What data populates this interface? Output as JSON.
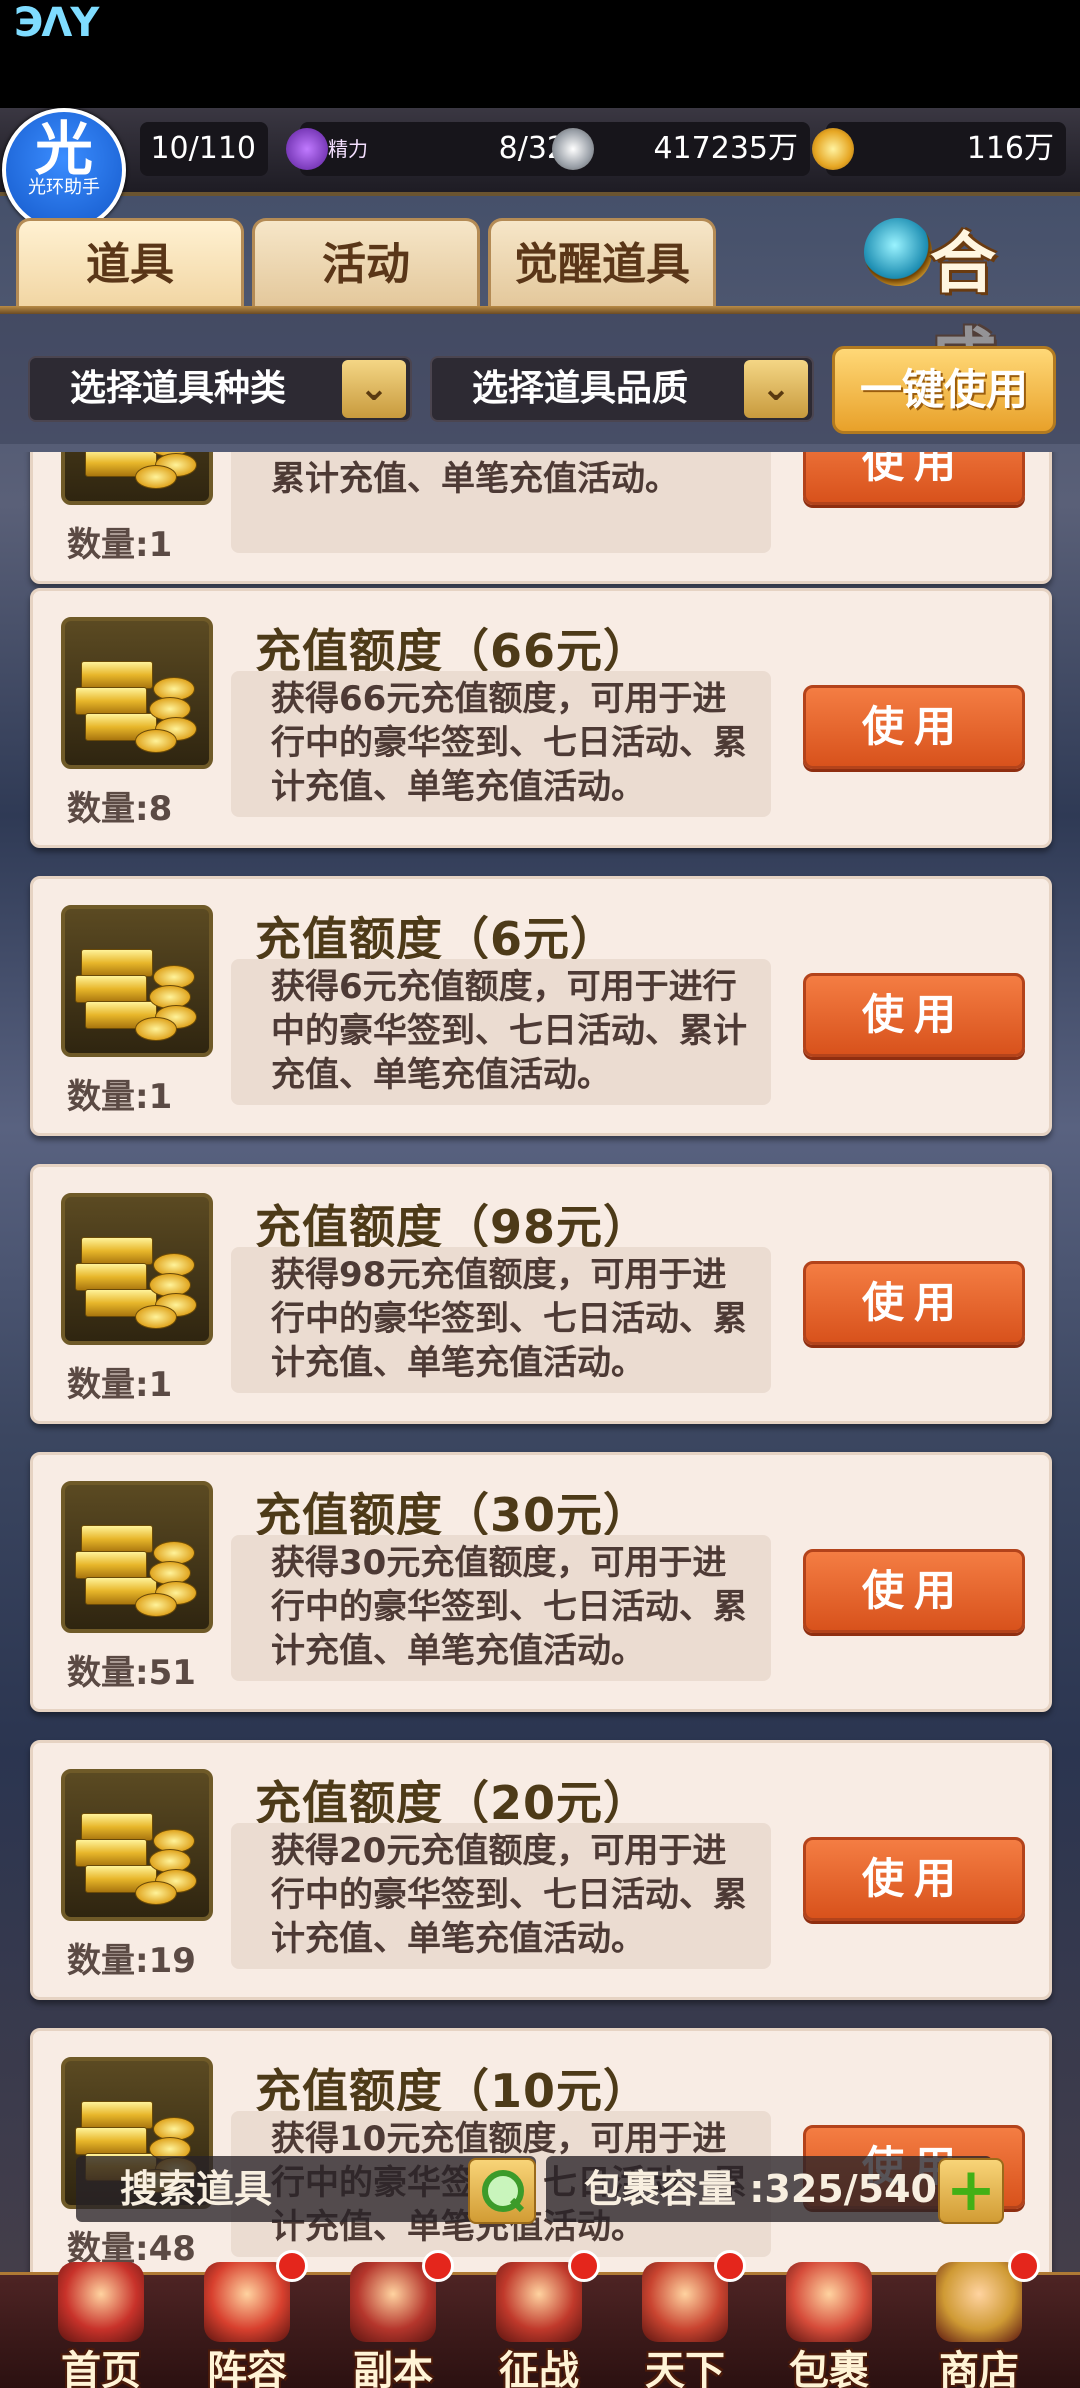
{
  "brand": "ЭΛY",
  "helper": {
    "big": "光",
    "small": "光环助手"
  },
  "resources": {
    "stamina": "10/110",
    "energy_icon_text": "精力",
    "energy": "8/32",
    "silver": "417235万",
    "gold": "116万"
  },
  "tabs": [
    "道具",
    "活动",
    "觉醒道具"
  ],
  "compose_label": "合成",
  "filters": {
    "type": "选择道具种类",
    "quality": "选择道具品质",
    "use_all": "一键使用"
  },
  "items": [
    {
      "title": "",
      "desc": "进行中的豪华签到、七日活动、累计充值、单笔充值活动。",
      "qty": "数量:1",
      "use": "使用"
    },
    {
      "title": "充值额度（66元）",
      "desc": "获得66元充值额度，可用于进行中的豪华签到、七日活动、累计充值、单笔充值活动。",
      "qty": "数量:8",
      "use": "使用"
    },
    {
      "title": "充值额度（6元）",
      "desc": "获得6元充值额度，可用于进行中的豪华签到、七日活动、累计充值、单笔充值活动。",
      "qty": "数量:1",
      "use": "使用"
    },
    {
      "title": "充值额度（98元）",
      "desc": "获得98元充值额度，可用于进行中的豪华签到、七日活动、累计充值、单笔充值活动。",
      "qty": "数量:1",
      "use": "使用"
    },
    {
      "title": "充值额度（30元）",
      "desc": "获得30元充值额度，可用于进行中的豪华签到、七日活动、累计充值、单笔充值活动。",
      "qty": "数量:51",
      "use": "使用"
    },
    {
      "title": "充值额度（20元）",
      "desc": "获得20元充值额度，可用于进行中的豪华签到、七日活动、累计充值、单笔充值活动。",
      "qty": "数量:19",
      "use": "使用"
    },
    {
      "title": "充值额度（10元）",
      "desc": "获得10元充值额度，可用于进行中的豪华签到、七日活动、累计充值、单笔充值活动。",
      "qty": "数量:48",
      "use": "使用"
    }
  ],
  "search": {
    "label": "搜索道具"
  },
  "capacity": {
    "label": "包裹容量 :325/540"
  },
  "nav": [
    {
      "label": "首页",
      "color": "#c8322a",
      "badge": false
    },
    {
      "label": "阵容",
      "color": "#d8402e",
      "badge": true
    },
    {
      "label": "副本",
      "color": "#b5362c",
      "badge": true
    },
    {
      "label": "征战",
      "color": "#c0392b",
      "badge": true
    },
    {
      "label": "天下",
      "color": "#c94430",
      "badge": true
    },
    {
      "label": "包裹",
      "color": "#d64c3a",
      "badge": false
    },
    {
      "label": "商店",
      "color": "#cf9a34",
      "badge": true
    }
  ],
  "colors": {
    "accent_use": "#e2622c",
    "gold": "#e8a12a",
    "card_bg": "#f8ece4"
  }
}
